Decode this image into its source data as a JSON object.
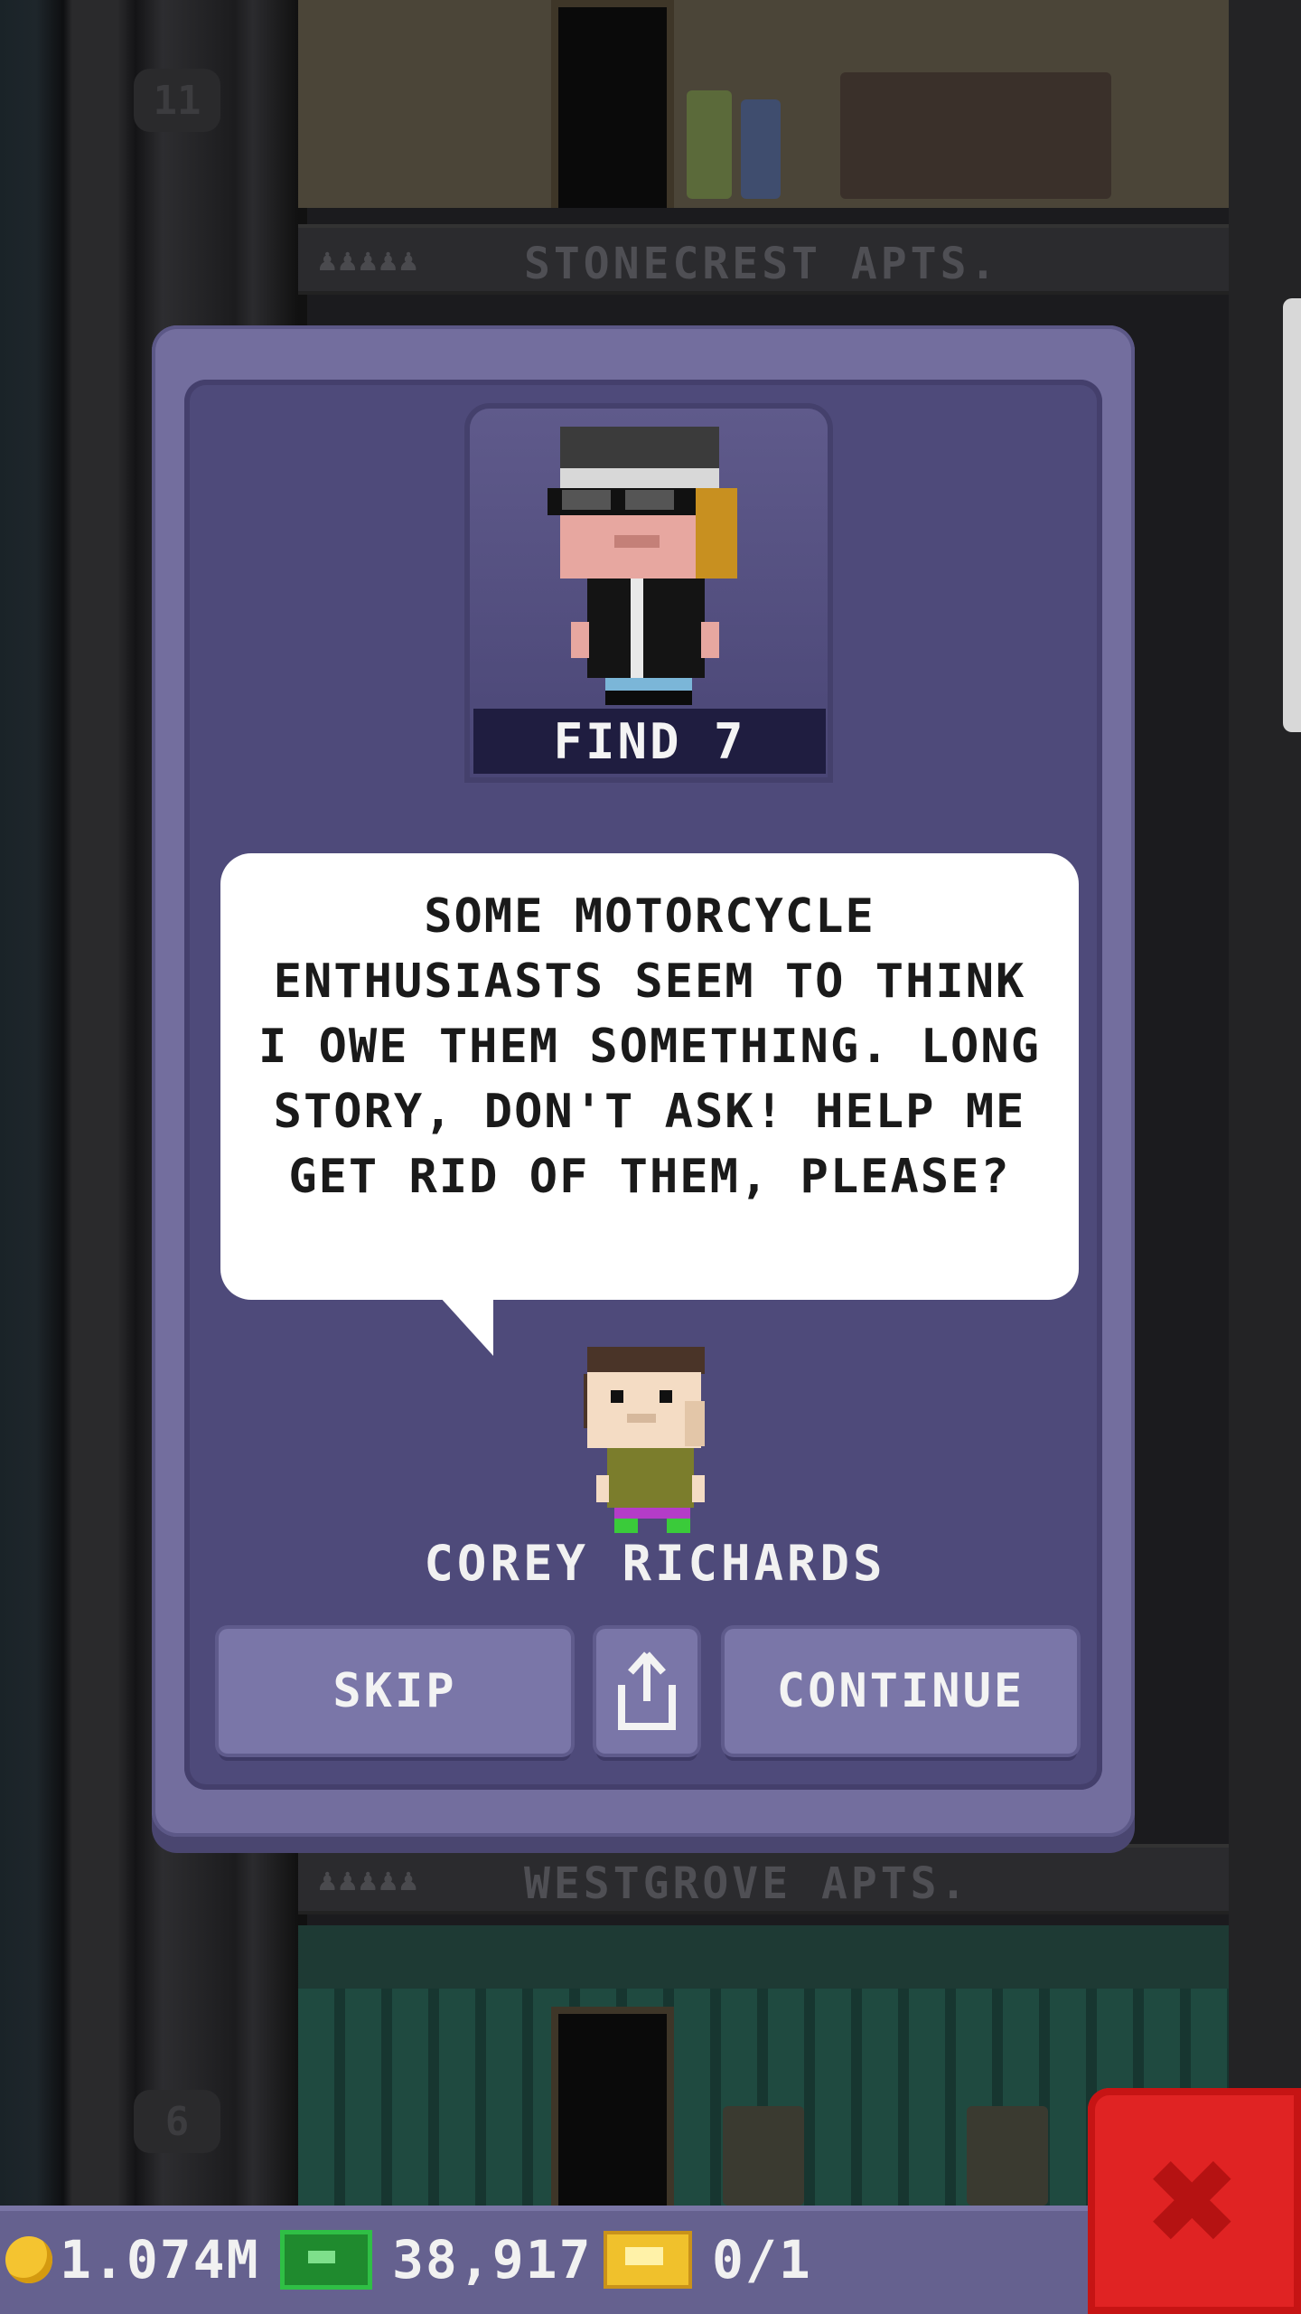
{
  "background": {
    "floor_top_number": "11",
    "floor_bottom_number": "6",
    "top_sign": {
      "people": "♟♟♟♟♟",
      "name": "STONECREST APTS."
    },
    "bottom_sign": {
      "people": "♟♟♟♟♟",
      "name": "WESTGROVE APTS."
    }
  },
  "dialog": {
    "mission_caption": "FIND 7",
    "speech": "SOME MOTORCYCLE ENTHUSIASTS SEEM TO THINK I OWE THEM SOMETHING. LONG STORY, DON'T ASK! HELP ME GET RID OF THEM, PLEASE?",
    "npc_name": "COREY RICHARDS",
    "buttons": {
      "skip": "SKIP",
      "continue": "CONTINUE"
    }
  },
  "hud": {
    "coins": "1.074M",
    "bux": "38,917",
    "tickets": "0/1"
  },
  "icons": {
    "close": "close-icon",
    "share": "share-icon",
    "coin": "coin-icon",
    "bux": "bux-icon",
    "ticket": "ticket-icon"
  },
  "colors": {
    "dialog_frame": "#736e9e",
    "dialog_body": "#4e4a7a",
    "button": "#7a76a8",
    "close_button": "#e02323",
    "hud": "#65618f"
  }
}
